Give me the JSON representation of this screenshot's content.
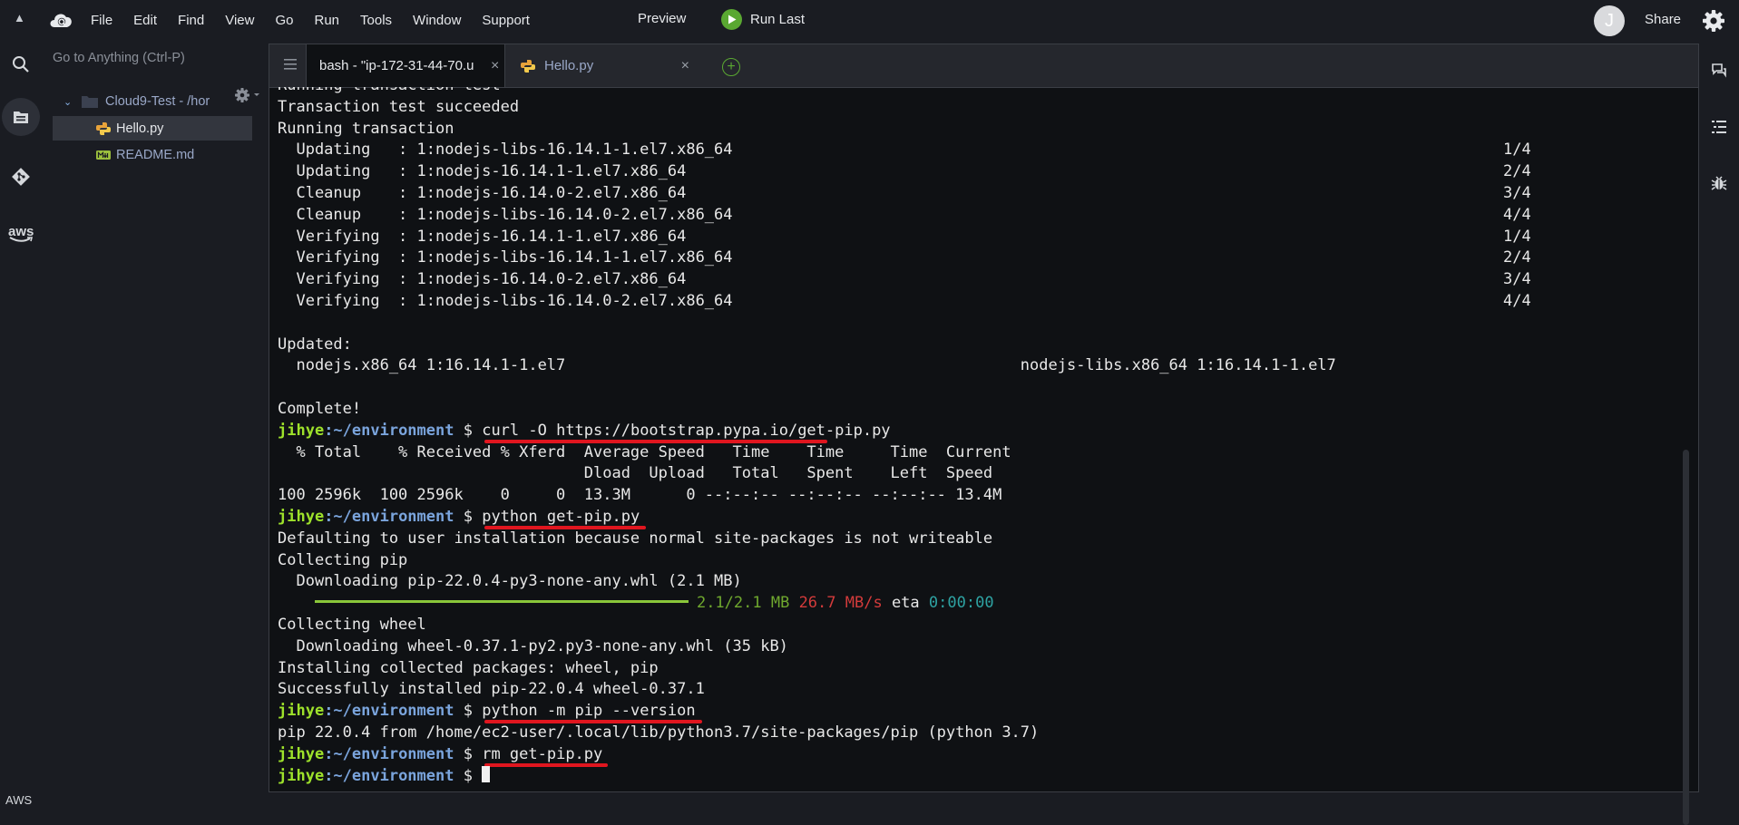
{
  "menubar": {
    "items": [
      "File",
      "Edit",
      "Find",
      "View",
      "Go",
      "Run",
      "Tools",
      "Window",
      "Support"
    ],
    "preview": "Preview",
    "run_last": "Run Last",
    "avatar_initial": "J",
    "share": "Share"
  },
  "rail": {
    "aws_label": "aws",
    "bottom_label": "AWS"
  },
  "filetree": {
    "goto_placeholder": "Go to Anything (Ctrl-P)",
    "root_name": "Cloud9-Test - /hor",
    "files": [
      {
        "name": "Hello.py",
        "icon": "python-file-icon",
        "selected": true
      },
      {
        "name": "README.md",
        "icon": "markdown-file-icon",
        "selected": false
      }
    ]
  },
  "tabs": [
    {
      "label": "bash - \"ip-172-31-44-70.u",
      "close": "×",
      "active": true
    },
    {
      "label": "Hello.py",
      "close": "×",
      "active": false
    }
  ],
  "terminal": {
    "prompt_user": "jihye",
    "prompt_path": ":~/environment",
    "prompt_sym": " $ ",
    "lines": [
      "Running transaction test",
      "Transaction test succeeded",
      "Running transaction",
      "  Updating   : 1:nodejs-libs-16.14.1-1.el7.x86_64                                                                                   1/4",
      "  Updating   : 1:nodejs-16.14.1-1.el7.x86_64                                                                                        2/4",
      "  Cleanup    : 1:nodejs-16.14.0-2.el7.x86_64                                                                                        3/4",
      "  Cleanup    : 1:nodejs-libs-16.14.0-2.el7.x86_64                                                                                   4/4",
      "  Verifying  : 1:nodejs-16.14.1-1.el7.x86_64                                                                                        1/4",
      "  Verifying  : 1:nodejs-libs-16.14.1-1.el7.x86_64                                                                                   2/4",
      "  Verifying  : 1:nodejs-16.14.0-2.el7.x86_64                                                                                        3/4",
      "  Verifying  : 1:nodejs-libs-16.14.0-2.el7.x86_64                                                                                   4/4",
      "",
      "Updated:",
      "  nodejs.x86_64 1:16.14.1-1.el7                                                 nodejs-libs.x86_64 1:16.14.1-1.el7",
      "",
      "Complete!"
    ],
    "cmd1": "curl -O https://bootstrap.pypa.io/get-pip.py",
    "curl_header1": "  % Total    % Received % Xferd  Average Speed   Time    Time     Time  Current",
    "curl_header2": "                                 Dload  Upload   Total   Spent    Left  Speed",
    "curl_stats": "100 2596k  100 2596k    0     0  13.3M      0 --:--:-- --:--:-- --:--:-- 13.4M",
    "cmd2": "python get-pip.py",
    "pip_lines1": [
      "Defaulting to user installation because normal site-packages is not writeable",
      "Collecting pip",
      "  Downloading pip-22.0.4-py3-none-any.whl (2.1 MB)"
    ],
    "progress": {
      "fraction": 1.0,
      "size": "2.1/2.1 MB",
      "speed": "26.7 MB/s",
      "eta_label": "eta",
      "eta": "0:00:00",
      "bar_color": "#8ac63a"
    },
    "pip_lines2": [
      "Collecting wheel",
      "  Downloading wheel-0.37.1-py2.py3-none-any.whl (35 kB)",
      "Installing collected packages: wheel, pip",
      "Successfully installed pip-22.0.4 wheel-0.37.1"
    ],
    "cmd3": "python -m pip --version",
    "pip_version": "pip 22.0.4 from /home/ec2-user/.local/lib/python3.7/site-packages/pip (python 3.7)",
    "cmd4": "rm get-pip.py"
  },
  "colors": {
    "prompt_user": "#9ee22b",
    "prompt_path": "#7aa4dc",
    "underline": "#e0161f",
    "speed": "#d33b3b",
    "eta": "#2ea3a3",
    "run_button": "#5aa832"
  }
}
